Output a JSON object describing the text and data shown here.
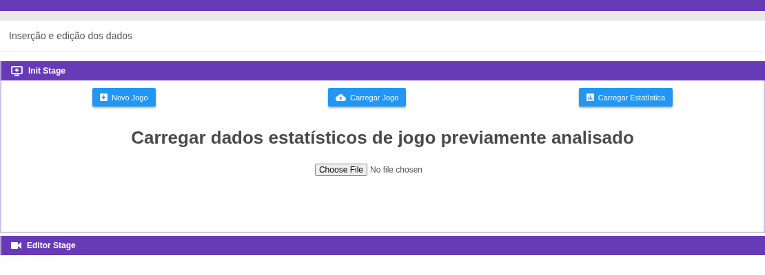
{
  "page_title": "Inserção e edição dos dados",
  "stages": [
    {
      "title": "Init Stage",
      "expanded": true,
      "buttons": [
        {
          "label": "Novo Jogo"
        },
        {
          "label": "Carregar Jogo"
        },
        {
          "label": "Carregar Estatística"
        }
      ],
      "heading": "Carregar dados estatísticos de jogo previamente analisado",
      "file_input": {
        "button": "Choose File",
        "status": "No file chosen"
      }
    },
    {
      "title": "Editor Stage",
      "expanded": false
    }
  ]
}
